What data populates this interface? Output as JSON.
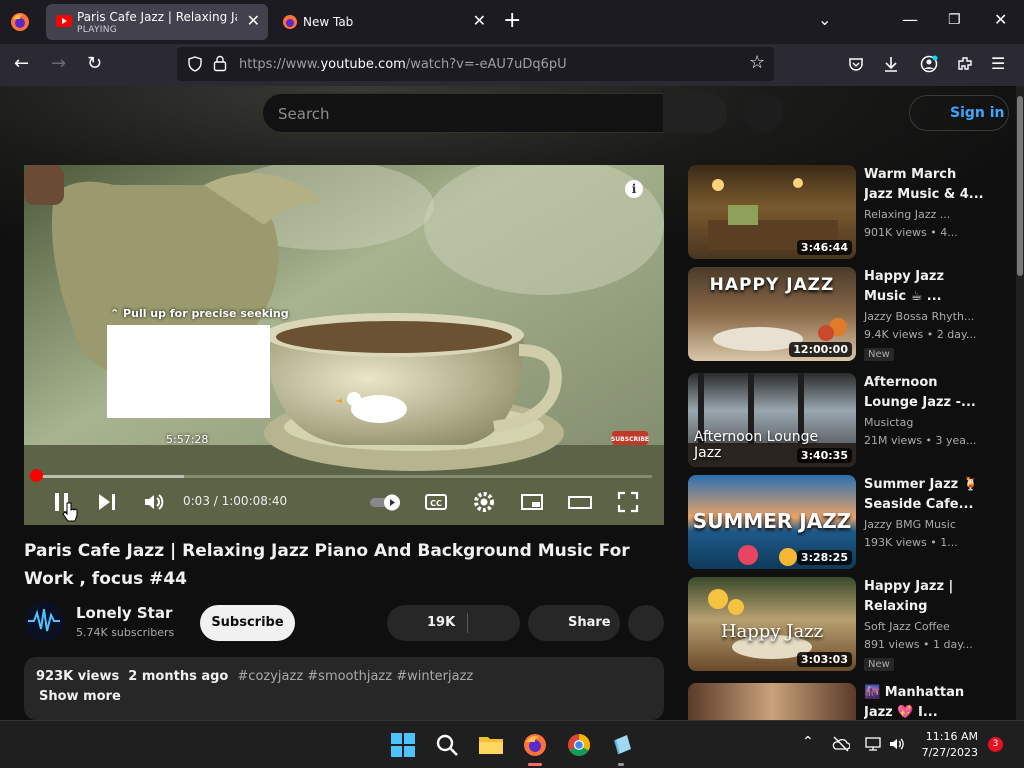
{
  "browser": {
    "tabs": [
      {
        "title": "Paris Cafe Jazz | Relaxing Jazz Pi",
        "status": "PLAYING",
        "active": true
      },
      {
        "title": "New Tab",
        "active": false
      }
    ],
    "url": {
      "scheme": "https://www.",
      "host": "youtube.com",
      "path": "/watch?v=-eAU7uDq6pU"
    }
  },
  "youtube": {
    "search_placeholder": "Search",
    "sign_in_label": "Sign in",
    "player": {
      "seek_hint": "Pull up for precise seeking",
      "preview_time": "5:57:28",
      "current_time": "0:03",
      "duration": "1:00:08:40",
      "time_display": "0:03 / 1:00:08:40",
      "progress_fraction": 0.0008,
      "loaded_fraction": 0.24,
      "overlay_badge": "SUBSCRIBE"
    },
    "video": {
      "title": "Paris Cafe Jazz | Relaxing Jazz Piano And Background Music For Work , focus #44",
      "channel": "Lonely Star",
      "subscribers": "5.74K subscribers",
      "subscribe_label": "Subscribe",
      "likes": "19K",
      "share_label": "Share",
      "views": "923K views",
      "age": "2 months ago",
      "tags": "#cozyjazz #smoothjazz #winterjazz",
      "show_more": "Show more"
    },
    "recommendations": [
      {
        "title": "Warm March Jazz Music & 4...",
        "channel": "Relaxing Jazz ...",
        "meta": "901K views  • 4...",
        "duration": "3:46:44",
        "thumb_text": "",
        "new": ""
      },
      {
        "title": "Happy Jazz Music ☕ ...",
        "channel": "Jazzy Bossa Rhyth...",
        "meta": "9.4K views  • 2 day...",
        "duration": "12:00:00",
        "thumb_text": "HAPPY JAZZ",
        "new": "New"
      },
      {
        "title": "Afternoon Lounge Jazz -...",
        "channel": "Musictag",
        "meta": "21M views  • 3 yea...",
        "duration": "3:40:35",
        "thumb_text": "Afternoon Lounge Jazz",
        "new": ""
      },
      {
        "title": "Summer Jazz 🍹 Seaside Cafe...",
        "channel": "Jazzy BMG Music",
        "meta": "193K views  • 1...",
        "duration": "3:28:25",
        "thumb_text": "SUMMER JAZZ",
        "new": ""
      },
      {
        "title": "Happy Jazz | Relaxing mornin...",
        "channel": "Soft Jazz Coffee",
        "meta": "891 views  • 1 day...",
        "duration": "3:03:03",
        "thumb_text": "Happy Jazz",
        "new": "New"
      },
      {
        "title": "🌆 Manhattan Jazz 💖 I...",
        "channel": "",
        "meta": "",
        "duration": "",
        "thumb_text": "",
        "new": ""
      }
    ]
  },
  "taskbar": {
    "time": "11:16 AM",
    "date": "7/27/2023",
    "notification_count": "3"
  },
  "colors": {
    "accent_red": "#ff0000",
    "link_blue": "#3ea6ff",
    "bg": "#0f0f0f"
  }
}
